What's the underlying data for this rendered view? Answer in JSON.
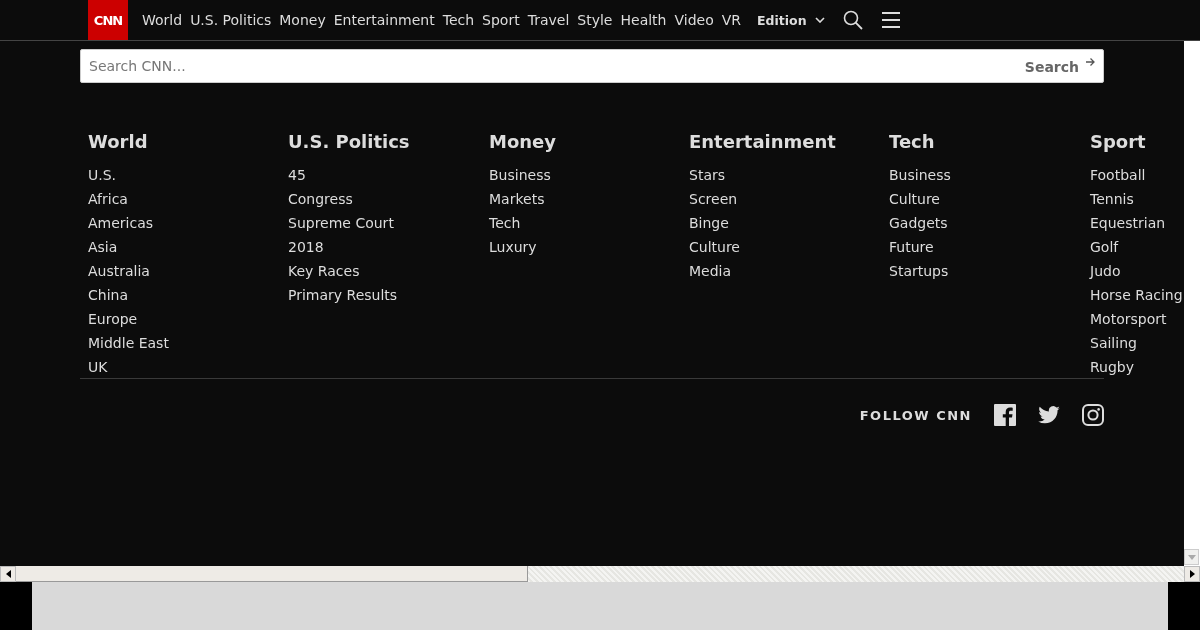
{
  "nav": {
    "logo": "CNN",
    "items": [
      "World",
      "U.S. Politics",
      "Money",
      "Entertainment",
      "Tech",
      "Sport",
      "Travel",
      "Style",
      "Health",
      "Video",
      "VR"
    ],
    "edition": "Edition"
  },
  "search": {
    "placeholder": "Search CNN...",
    "button": "Search"
  },
  "sections": [
    {
      "title": "World",
      "links": [
        "U.S.",
        "Africa",
        "Americas",
        "Asia",
        "Australia",
        "China",
        "Europe",
        "Middle East",
        "UK"
      ]
    },
    {
      "title": "U.S. Politics",
      "links": [
        "45",
        "Congress",
        "Supreme Court",
        "2018",
        "Key Races",
        "Primary Results"
      ]
    },
    {
      "title": "Money",
      "links": [
        "Business",
        "Markets",
        "Tech",
        "Luxury"
      ]
    },
    {
      "title": "Entertainment",
      "links": [
        "Stars",
        "Screen",
        "Binge",
        "Culture",
        "Media"
      ]
    },
    {
      "title": "Tech",
      "links": [
        "Business",
        "Culture",
        "Gadgets",
        "Future",
        "Startups"
      ]
    },
    {
      "title": "Sport",
      "links": [
        "Football",
        "Tennis",
        "Equestrian",
        "Golf",
        "Judo",
        "Horse Racing",
        "Motorsport",
        "Sailing",
        "Rugby"
      ]
    }
  ],
  "follow": {
    "label": "FOLLOW CNN"
  }
}
